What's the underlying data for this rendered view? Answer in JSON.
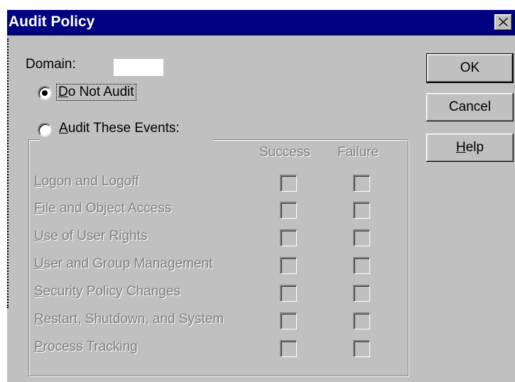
{
  "dialog": {
    "title": "Audit Policy",
    "close_glyph": "✕"
  },
  "domain": {
    "label": "Domain:",
    "value": ""
  },
  "radios": {
    "do_not_audit": {
      "label": "Do Not Audit",
      "selected": true
    },
    "audit_these_events": {
      "label": "Audit These Events:",
      "selected": false
    }
  },
  "columns": {
    "success": "Success",
    "failure": "Failure"
  },
  "events": [
    {
      "label": "Logon and Logoff",
      "success": false,
      "failure": false
    },
    {
      "label": "File and Object Access",
      "success": false,
      "failure": false
    },
    {
      "label": "Use of User Rights",
      "success": false,
      "failure": false
    },
    {
      "label": "User and Group Management",
      "success": false,
      "failure": false
    },
    {
      "label": "Security Policy Changes",
      "success": false,
      "failure": false
    },
    {
      "label": "Restart, Shutdown, and System",
      "success": false,
      "failure": false
    },
    {
      "label": "Process Tracking",
      "success": false,
      "failure": false
    }
  ],
  "buttons": {
    "ok": "OK",
    "cancel": "Cancel",
    "help": "Help"
  },
  "colors": {
    "titlebar": "#000080",
    "face": "#c0c0c0",
    "disabled_text": "#808080"
  }
}
